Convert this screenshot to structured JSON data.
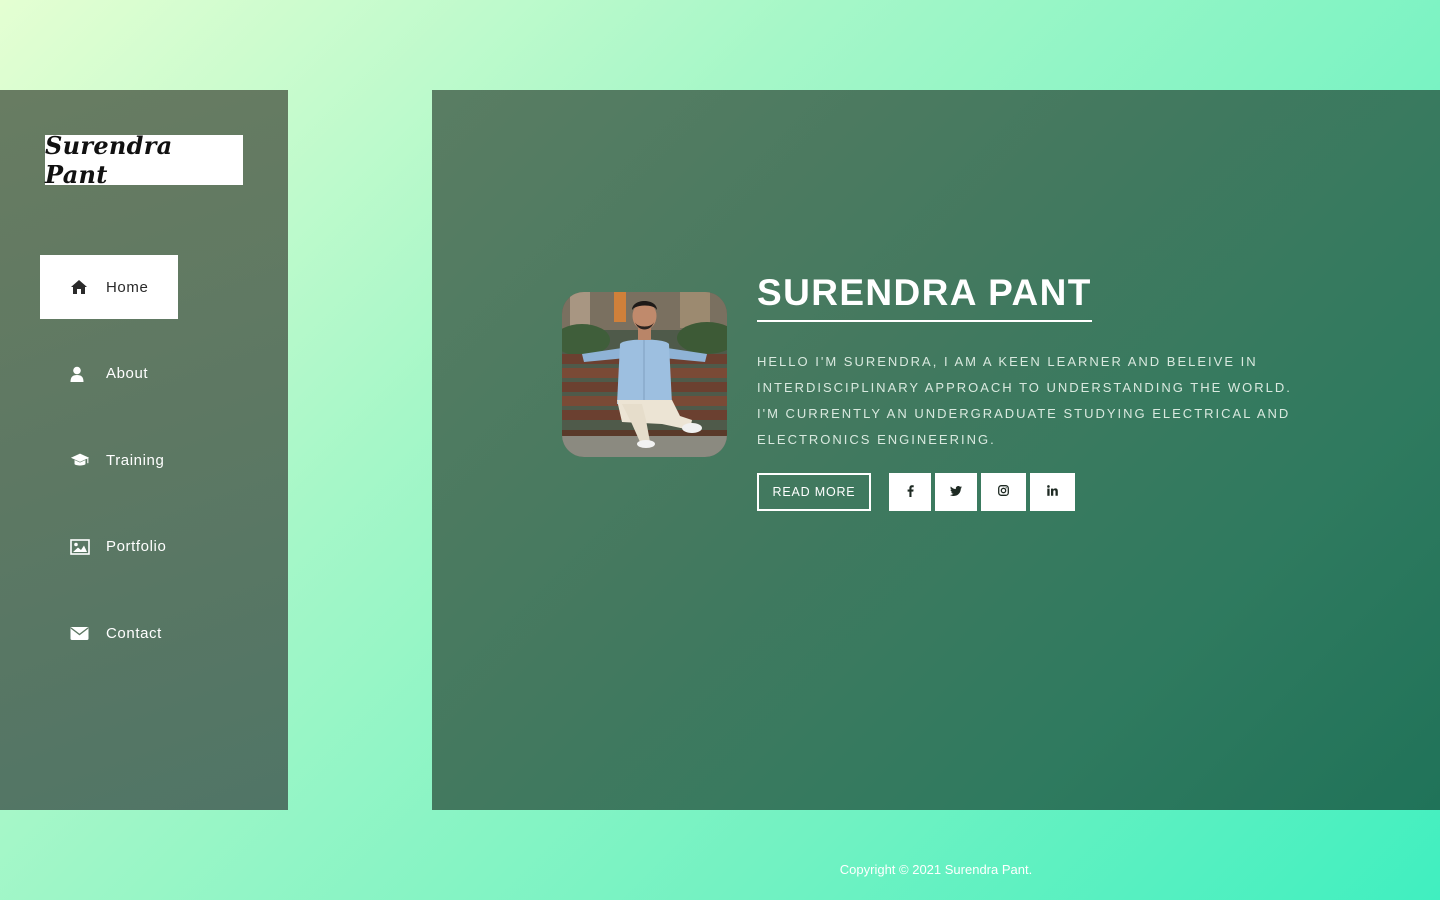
{
  "brand": {
    "logo_text": "Surendra Pant"
  },
  "sidebar": {
    "items": [
      {
        "label": "Home",
        "icon": "home-icon",
        "active": true
      },
      {
        "label": "About",
        "icon": "user-icon",
        "active": false
      },
      {
        "label": "Training",
        "icon": "graduation-cap-icon",
        "active": false
      },
      {
        "label": "Portfolio",
        "icon": "image-icon",
        "active": false
      },
      {
        "label": "Contact",
        "icon": "envelope-icon",
        "active": false
      }
    ]
  },
  "hero": {
    "name": "SURENDRA PANT",
    "bio": "Hello I'm Surendra, I am a keen learner and beleive in interdisciplinary approach to understanding the world. I'm currently an undergraduate studying Electrical and Electronics Engineering.",
    "read_more_label": "READ MORE",
    "avatar_alt": "Surendra Pant",
    "socials": [
      {
        "glyph": "f",
        "icon": "facebook-icon"
      },
      {
        "glyph": "🐦",
        "icon": "twitter-icon"
      },
      {
        "glyph": "◎",
        "icon": "instagram-icon"
      },
      {
        "glyph": "in",
        "icon": "linkedin-icon"
      }
    ]
  },
  "footer": {
    "copyright": "Copyright © 2021 Surendra Pant."
  },
  "colors": {
    "sidebar_bg": "#607a63",
    "main_bg": "#3a7a60",
    "page_gradient_start": "#e4ffd2",
    "page_gradient_end": "#40efc0",
    "active_nav_bg": "#ffffff"
  }
}
